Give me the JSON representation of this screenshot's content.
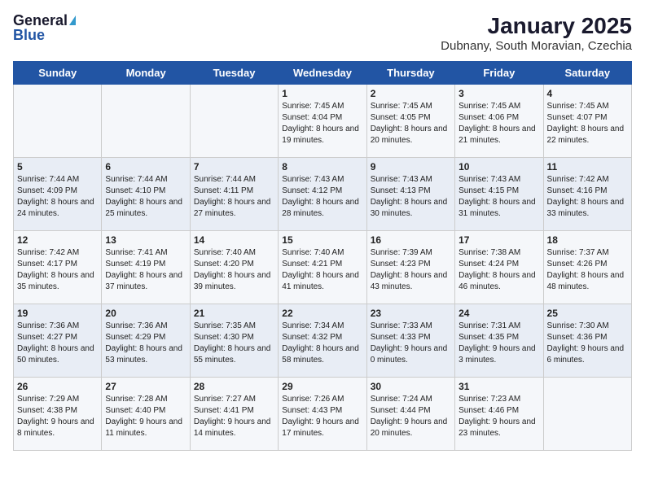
{
  "logo": {
    "general": "General",
    "blue": "Blue"
  },
  "title": "January 2025",
  "subtitle": "Dubnany, South Moravian, Czechia",
  "days_of_week": [
    "Sunday",
    "Monday",
    "Tuesday",
    "Wednesday",
    "Thursday",
    "Friday",
    "Saturday"
  ],
  "weeks": [
    [
      {
        "day": "",
        "info": ""
      },
      {
        "day": "",
        "info": ""
      },
      {
        "day": "",
        "info": ""
      },
      {
        "day": "1",
        "info": "Sunrise: 7:45 AM\nSunset: 4:04 PM\nDaylight: 8 hours and 19 minutes."
      },
      {
        "day": "2",
        "info": "Sunrise: 7:45 AM\nSunset: 4:05 PM\nDaylight: 8 hours and 20 minutes."
      },
      {
        "day": "3",
        "info": "Sunrise: 7:45 AM\nSunset: 4:06 PM\nDaylight: 8 hours and 21 minutes."
      },
      {
        "day": "4",
        "info": "Sunrise: 7:45 AM\nSunset: 4:07 PM\nDaylight: 8 hours and 22 minutes."
      }
    ],
    [
      {
        "day": "5",
        "info": "Sunrise: 7:44 AM\nSunset: 4:09 PM\nDaylight: 8 hours and 24 minutes."
      },
      {
        "day": "6",
        "info": "Sunrise: 7:44 AM\nSunset: 4:10 PM\nDaylight: 8 hours and 25 minutes."
      },
      {
        "day": "7",
        "info": "Sunrise: 7:44 AM\nSunset: 4:11 PM\nDaylight: 8 hours and 27 minutes."
      },
      {
        "day": "8",
        "info": "Sunrise: 7:43 AM\nSunset: 4:12 PM\nDaylight: 8 hours and 28 minutes."
      },
      {
        "day": "9",
        "info": "Sunrise: 7:43 AM\nSunset: 4:13 PM\nDaylight: 8 hours and 30 minutes."
      },
      {
        "day": "10",
        "info": "Sunrise: 7:43 AM\nSunset: 4:15 PM\nDaylight: 8 hours and 31 minutes."
      },
      {
        "day": "11",
        "info": "Sunrise: 7:42 AM\nSunset: 4:16 PM\nDaylight: 8 hours and 33 minutes."
      }
    ],
    [
      {
        "day": "12",
        "info": "Sunrise: 7:42 AM\nSunset: 4:17 PM\nDaylight: 8 hours and 35 minutes."
      },
      {
        "day": "13",
        "info": "Sunrise: 7:41 AM\nSunset: 4:19 PM\nDaylight: 8 hours and 37 minutes."
      },
      {
        "day": "14",
        "info": "Sunrise: 7:40 AM\nSunset: 4:20 PM\nDaylight: 8 hours and 39 minutes."
      },
      {
        "day": "15",
        "info": "Sunrise: 7:40 AM\nSunset: 4:21 PM\nDaylight: 8 hours and 41 minutes."
      },
      {
        "day": "16",
        "info": "Sunrise: 7:39 AM\nSunset: 4:23 PM\nDaylight: 8 hours and 43 minutes."
      },
      {
        "day": "17",
        "info": "Sunrise: 7:38 AM\nSunset: 4:24 PM\nDaylight: 8 hours and 46 minutes."
      },
      {
        "day": "18",
        "info": "Sunrise: 7:37 AM\nSunset: 4:26 PM\nDaylight: 8 hours and 48 minutes."
      }
    ],
    [
      {
        "day": "19",
        "info": "Sunrise: 7:36 AM\nSunset: 4:27 PM\nDaylight: 8 hours and 50 minutes."
      },
      {
        "day": "20",
        "info": "Sunrise: 7:36 AM\nSunset: 4:29 PM\nDaylight: 8 hours and 53 minutes."
      },
      {
        "day": "21",
        "info": "Sunrise: 7:35 AM\nSunset: 4:30 PM\nDaylight: 8 hours and 55 minutes."
      },
      {
        "day": "22",
        "info": "Sunrise: 7:34 AM\nSunset: 4:32 PM\nDaylight: 8 hours and 58 minutes."
      },
      {
        "day": "23",
        "info": "Sunrise: 7:33 AM\nSunset: 4:33 PM\nDaylight: 9 hours and 0 minutes."
      },
      {
        "day": "24",
        "info": "Sunrise: 7:31 AM\nSunset: 4:35 PM\nDaylight: 9 hours and 3 minutes."
      },
      {
        "day": "25",
        "info": "Sunrise: 7:30 AM\nSunset: 4:36 PM\nDaylight: 9 hours and 6 minutes."
      }
    ],
    [
      {
        "day": "26",
        "info": "Sunrise: 7:29 AM\nSunset: 4:38 PM\nDaylight: 9 hours and 8 minutes."
      },
      {
        "day": "27",
        "info": "Sunrise: 7:28 AM\nSunset: 4:40 PM\nDaylight: 9 hours and 11 minutes."
      },
      {
        "day": "28",
        "info": "Sunrise: 7:27 AM\nSunset: 4:41 PM\nDaylight: 9 hours and 14 minutes."
      },
      {
        "day": "29",
        "info": "Sunrise: 7:26 AM\nSunset: 4:43 PM\nDaylight: 9 hours and 17 minutes."
      },
      {
        "day": "30",
        "info": "Sunrise: 7:24 AM\nSunset: 4:44 PM\nDaylight: 9 hours and 20 minutes."
      },
      {
        "day": "31",
        "info": "Sunrise: 7:23 AM\nSunset: 4:46 PM\nDaylight: 9 hours and 23 minutes."
      },
      {
        "day": "",
        "info": ""
      }
    ]
  ]
}
